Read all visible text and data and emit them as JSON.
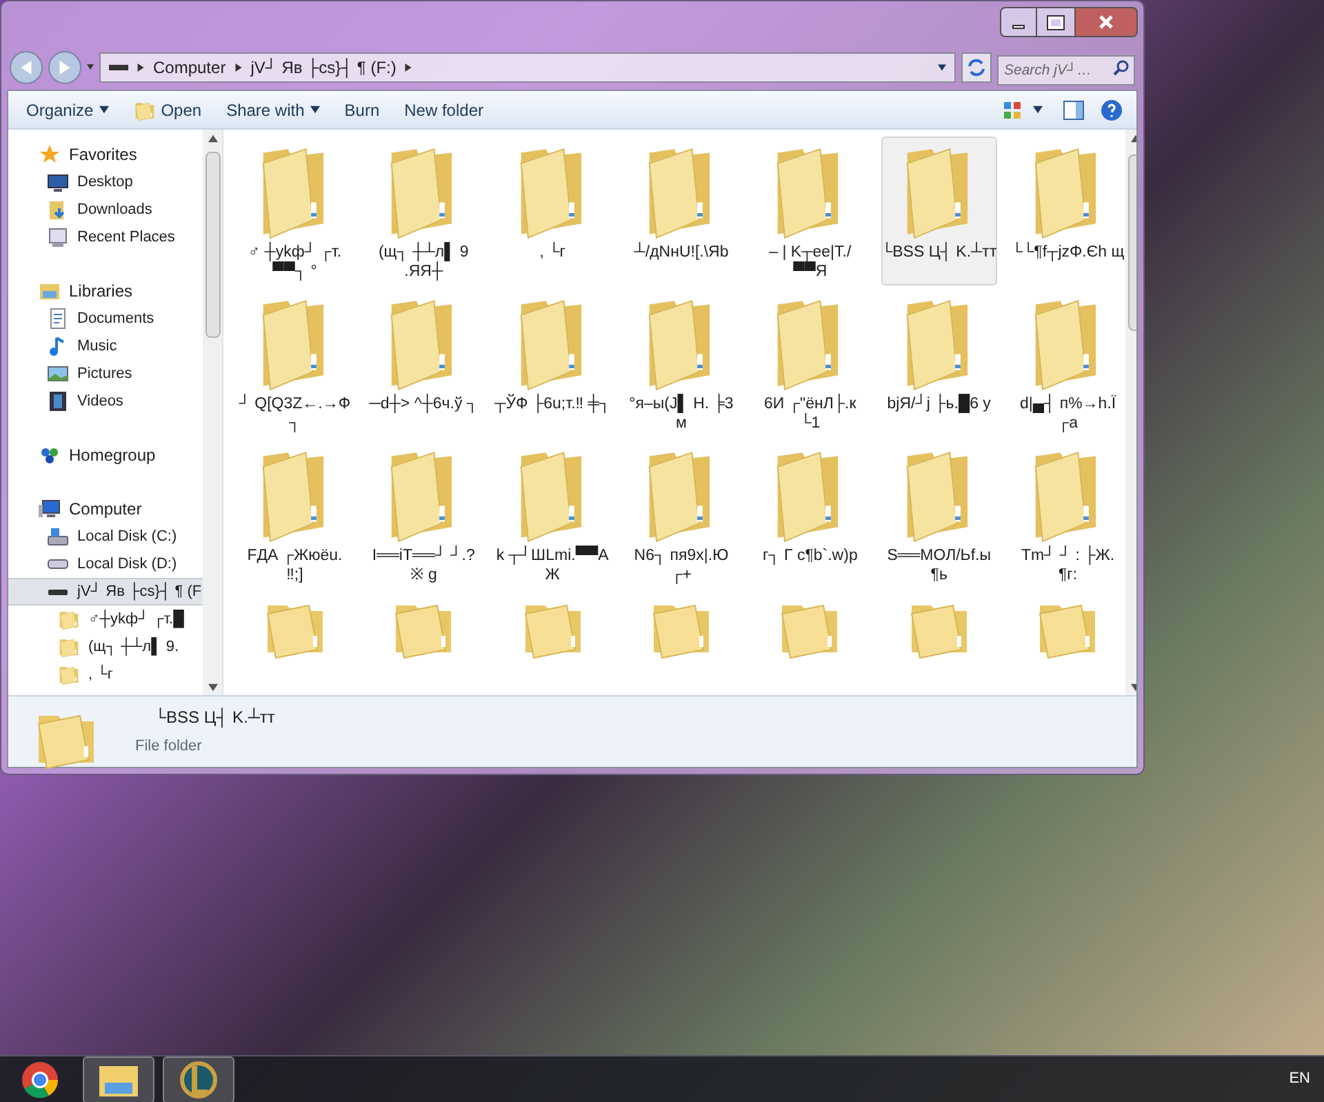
{
  "window": {
    "address": [
      "Computer",
      "jV┘ Яв ├cs}┤ ¶ (F:)"
    ],
    "search": {
      "placeholder": "Search jV┘…"
    }
  },
  "toolbar": [
    {
      "label": "Organize",
      "kind": "menu"
    },
    {
      "label": "Open",
      "kind": "open"
    },
    {
      "label": "Share with",
      "kind": "menu"
    },
    {
      "label": "Burn",
      "kind": "plain"
    },
    {
      "label": "New folder",
      "kind": "plain"
    }
  ],
  "sidebar": {
    "groups": [
      {
        "label": "Favorites",
        "kind": "star",
        "items": [
          {
            "label": "Desktop",
            "kind": "desktop",
            "selected": false
          },
          {
            "label": "Downloads",
            "kind": "downloads",
            "selected": false
          },
          {
            "label": "Recent Places",
            "kind": "recent",
            "selected": false
          }
        ]
      },
      {
        "label": "Libraries",
        "kind": "library",
        "items": [
          {
            "label": "Documents",
            "kind": "document",
            "selected": false
          },
          {
            "label": "Music",
            "kind": "music",
            "selected": false
          },
          {
            "label": "Pictures",
            "kind": "picture",
            "selected": false
          },
          {
            "label": "Videos",
            "kind": "video",
            "selected": false
          }
        ]
      },
      {
        "label": "Homegroup",
        "kind": "homegroup"
      },
      {
        "label": "Computer",
        "kind": "computer",
        "items": [
          {
            "label": "Local Disk (C:)",
            "kind": "windisk",
            "selected": false
          },
          {
            "label": "Local Disk (D:)",
            "kind": "disk",
            "selected": false
          },
          {
            "label": "jV┘ Яв ├cs}┤ ¶ (F",
            "kind": "drive",
            "selected": true,
            "children": [
              {
                "label": "♂┼ykф┘ ┌т.█",
                "kind": "folder",
                "selected": false
              },
              {
                "label": "(щ┐ ┼┴л▌ 9.",
                "kind": "folder",
                "selected": false
              },
              {
                "label": ", └г",
                "kind": "folder",
                "selected": false
              }
            ]
          }
        ]
      }
    ]
  },
  "folders": [
    {
      "kind": "folder",
      "name": "♂ ┼ykф┘ ┌т. ▀▀┐ °",
      "selected": false
    },
    {
      "kind": "folder",
      "name": "(щ┐ ┼┴л▌ 9 .ЯЯ┼",
      "selected": false
    },
    {
      "kind": "folder",
      "name": ", └г",
      "selected": false
    },
    {
      "kind": "folder",
      "name": "┴/дNнU![.\\Яb",
      "selected": false
    },
    {
      "kind": "folder",
      "name": "– | K┬ee|T./ ▀▀Я",
      "selected": false
    },
    {
      "kind": "folder",
      "name": "└BSS Ц┤ K.┴тт",
      "selected": true
    },
    {
      "kind": "folder",
      "name": "└└¶f┬jzΦ.Єh щ",
      "selected": false
    },
    {
      "kind": "folder",
      "name": "┘ Q[Q3Z←.→Ф ┐",
      "selected": false
    },
    {
      "kind": "folder",
      "name": "─d┼> ^┼6ч.ў ┐",
      "selected": false
    },
    {
      "kind": "folder",
      "name": "┬ЎФ ├6u;т.‼ ╪┐",
      "selected": false
    },
    {
      "kind": "folder",
      "name": "°я–ы(J▌ H. ╞3 м",
      "selected": false
    },
    {
      "kind": "folder",
      "name": "6И ┌\"ёнЛ├.к └1",
      "selected": false
    },
    {
      "kind": "folder",
      "name": "bjЯ/┘j ├ь.█6 у",
      "selected": false
    },
    {
      "kind": "folder",
      "name": "d|▄┤ п%→h.Ї ┌a",
      "selected": false
    },
    {
      "kind": "folder",
      "name": "FДА ┌Жюёu. ‼;]",
      "selected": false
    },
    {
      "kind": "folder",
      "name": "I══iT══┘ ┘.?※ g",
      "selected": false
    },
    {
      "kind": "folder",
      "name": "k ┬┘ШLmi.▀▀A Ж",
      "selected": false
    },
    {
      "kind": "folder",
      "name": "N6┐ пя9х|.Ю ┌+",
      "selected": false
    },
    {
      "kind": "folder",
      "name": "г┐ Г с¶b`.w)p",
      "selected": false
    },
    {
      "kind": "folder",
      "name": "S══МОЛ/Ьf.ы ¶ь",
      "selected": false
    },
    {
      "kind": "folder",
      "name": "Tm┘ ┘ : ├Ж. ¶г:",
      "selected": false
    },
    {
      "kind": "folder-cut"
    },
    {
      "kind": "folder-cut"
    },
    {
      "kind": "folder-cut"
    },
    {
      "kind": "folder-cut"
    },
    {
      "kind": "folder-cut"
    },
    {
      "kind": "folder-cut"
    },
    {
      "kind": "folder-cut"
    }
  ],
  "details": {
    "name": "└BSS Ц┤ K.┴тт",
    "type": "File folder"
  },
  "taskbar": {
    "apps": [
      {
        "kind": "chrome",
        "selected": false
      },
      {
        "kind": "explorer",
        "selected": true
      },
      {
        "kind": "game",
        "selected": true
      }
    ],
    "language": "EN"
  }
}
